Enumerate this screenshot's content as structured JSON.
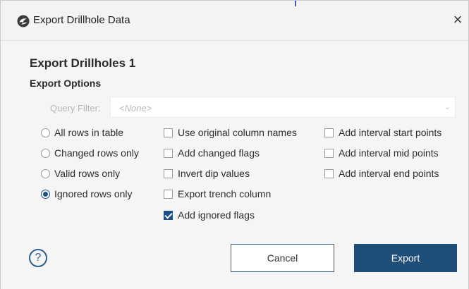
{
  "window": {
    "title": "Export Drillhole Data",
    "close_glyph": "×",
    "app_icon": "leapfrog-logo-icon"
  },
  "main": {
    "heading": "Export Drillholes 1",
    "subheading": "Export Options",
    "query_filter": {
      "label": "Query Filter:",
      "value": "<None>",
      "enabled": false
    }
  },
  "rows_radio": [
    {
      "label": "All rows in table",
      "selected": false
    },
    {
      "label": "Changed rows only",
      "selected": false
    },
    {
      "label": "Valid rows only",
      "selected": false
    },
    {
      "label": "Ignored rows only",
      "selected": true
    }
  ],
  "options_col1": [
    {
      "label": "Use original column names",
      "checked": false
    },
    {
      "label": "Add changed flags",
      "checked": false
    },
    {
      "label": "Invert dip values",
      "checked": false
    },
    {
      "label": "Export trench column",
      "checked": false
    },
    {
      "label": "Add ignored flags",
      "checked": true
    }
  ],
  "options_col2": [
    {
      "label": "Add interval start points",
      "checked": false
    },
    {
      "label": "Add interval mid points",
      "checked": false
    },
    {
      "label": "Add interval end points",
      "checked": false
    }
  ],
  "footer": {
    "help_glyph": "?",
    "cancel_label": "Cancel",
    "export_label": "Export"
  },
  "colors": {
    "accent": "#1f4e79",
    "dialog_bg": "#f3f3f3"
  }
}
